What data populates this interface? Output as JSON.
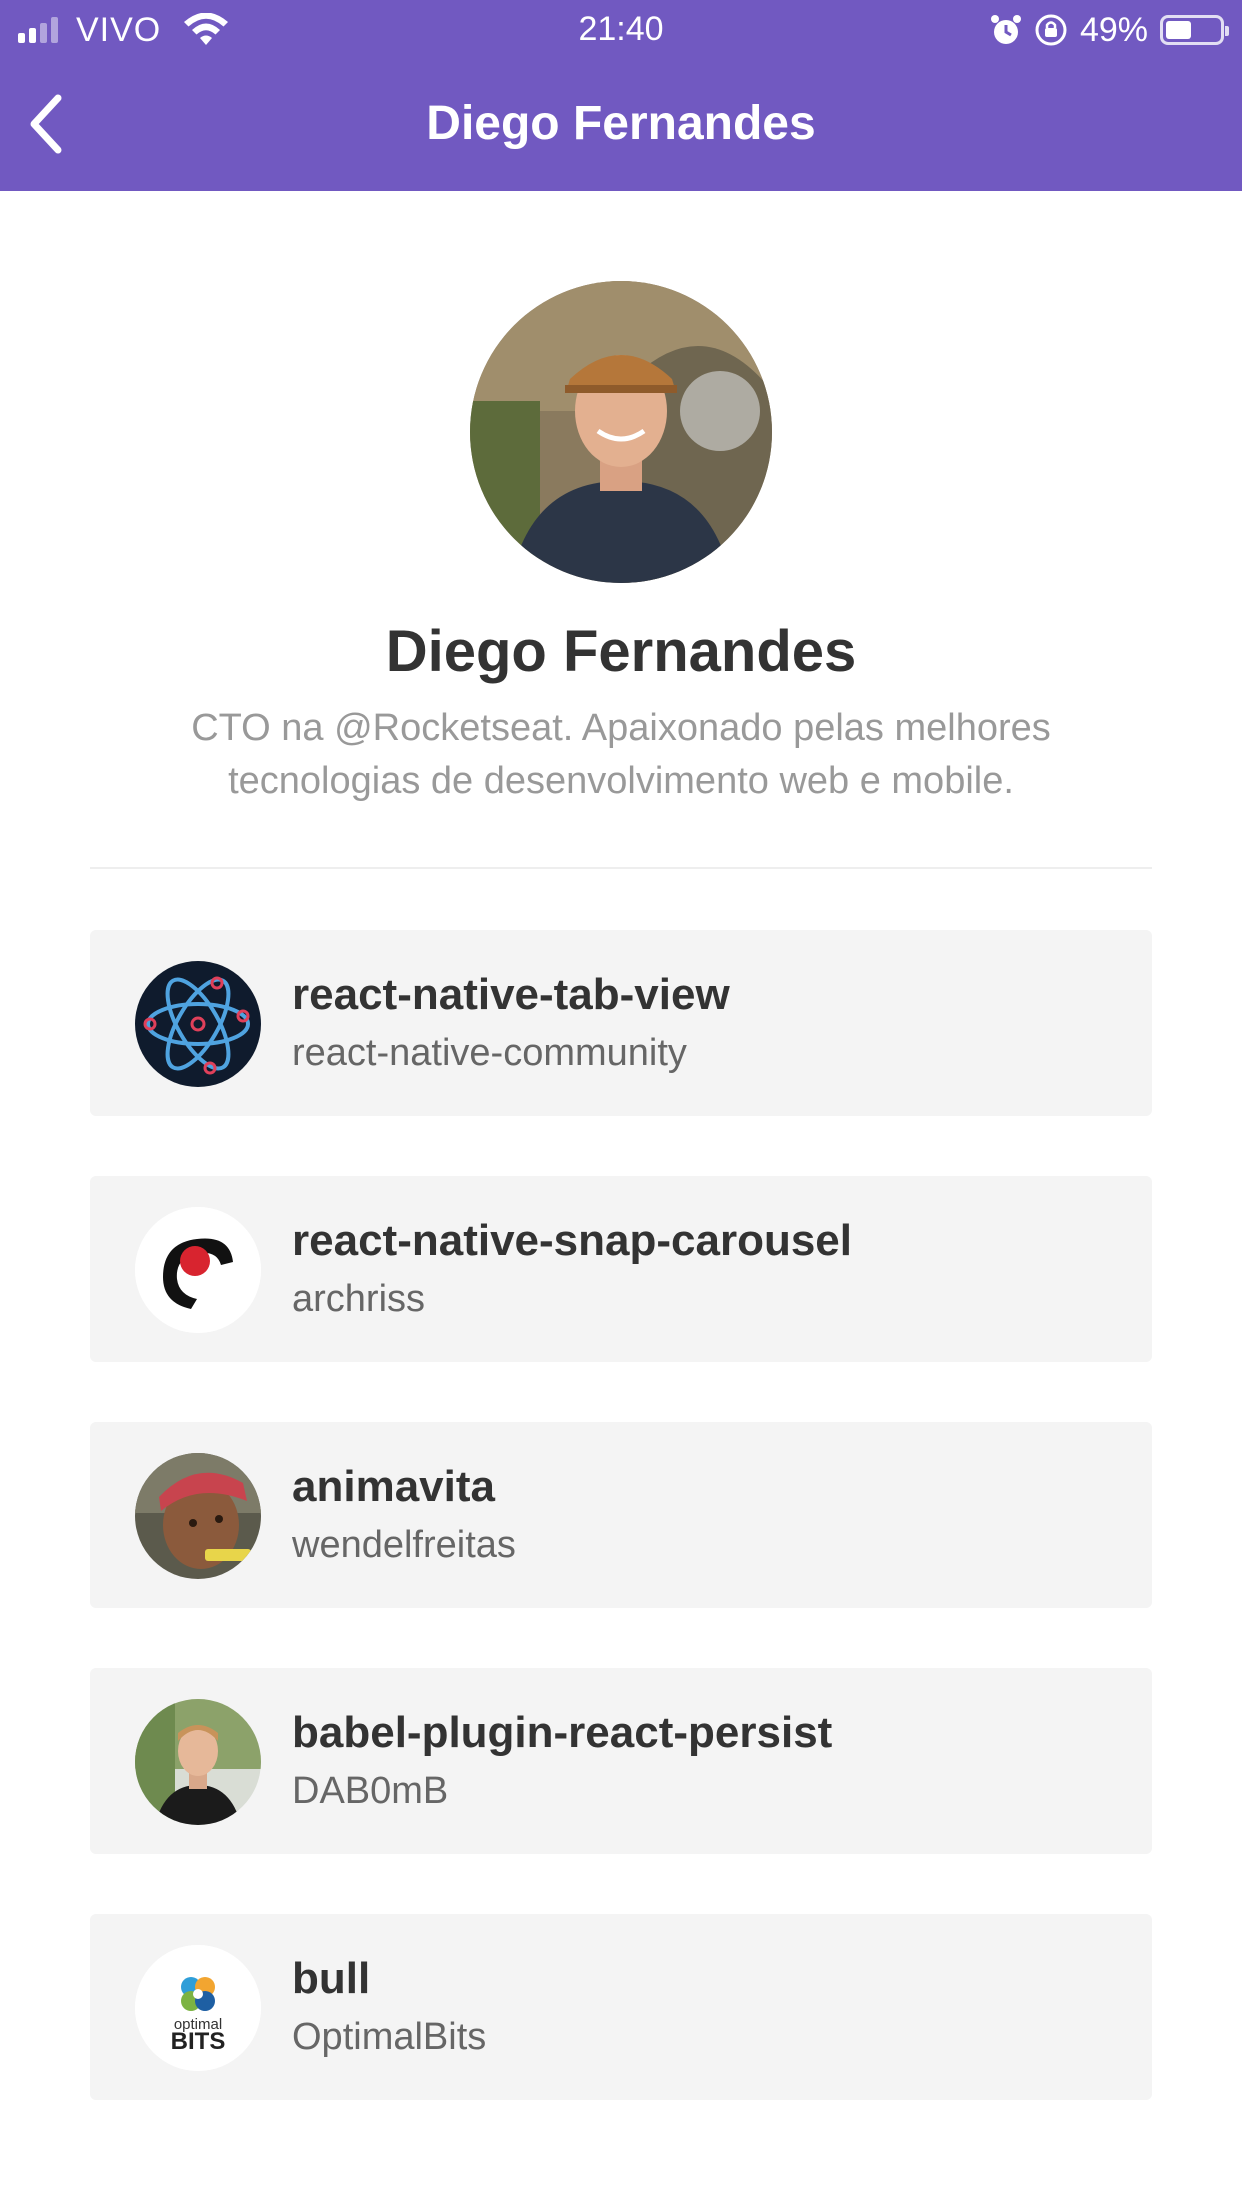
{
  "status_bar": {
    "carrier": "VIVO",
    "time": "21:40",
    "battery": "49%",
    "battery_level": 0.49,
    "icons": [
      "signal-icon",
      "wifi-icon",
      "alarm-icon",
      "orientation-lock-icon",
      "battery-icon"
    ]
  },
  "nav": {
    "title": "Diego Fernandes",
    "back_icon": "chevron-left-icon"
  },
  "profile": {
    "name": "Diego Fernandes",
    "bio_line1": "CTO na @Rocketseat. Apaixonado pelas melhores",
    "bio_line2": "tecnologias de desenvolvimento web e mobile."
  },
  "repos": [
    {
      "title": "react-native-tab-view",
      "author": "react-native-community",
      "avatar": "atom-logo"
    },
    {
      "title": "react-native-snap-carousel",
      "author": "archriss",
      "avatar": "archriss-logo"
    },
    {
      "title": "animavita",
      "author": "wendelfreitas",
      "avatar": "user-photo"
    },
    {
      "title": "babel-plugin-react-persist",
      "author": "DAB0mB",
      "avatar": "user-photo"
    },
    {
      "title": "bull",
      "author": "OptimalBits",
      "avatar": "optimalbits-logo"
    }
  ],
  "logos": {
    "optimalbits_line1": "optimal",
    "optimalbits_line2": "BITS"
  },
  "colors": {
    "header": "#7159c1",
    "card": "#f4f4f4",
    "title": "#333333",
    "bio": "#999999"
  }
}
